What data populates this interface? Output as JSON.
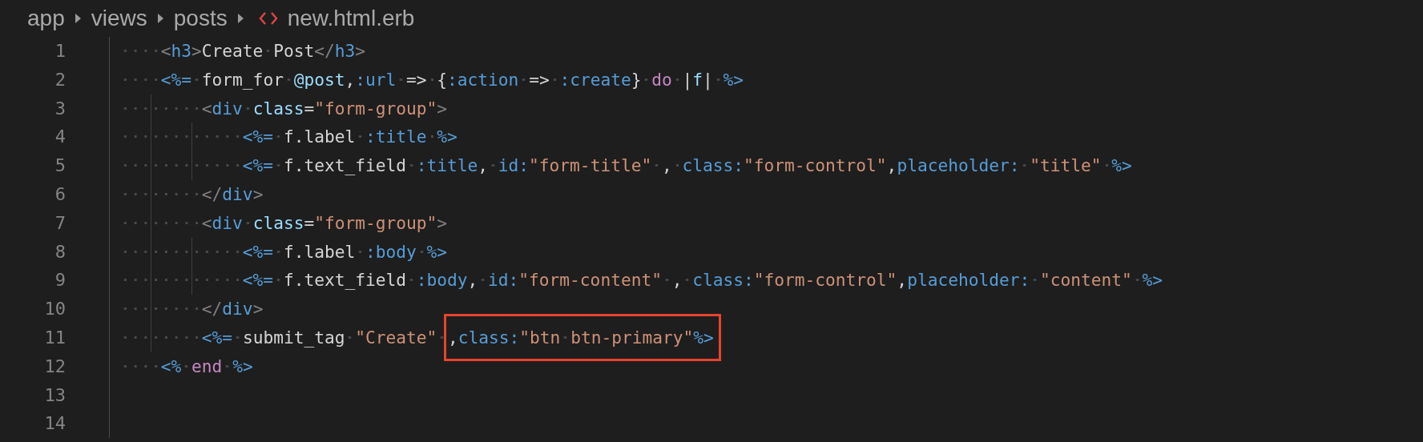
{
  "breadcrumb": [
    {
      "kind": "folder",
      "text": "app"
    },
    {
      "kind": "folder",
      "text": "views"
    },
    {
      "kind": "folder",
      "text": "posts"
    },
    {
      "kind": "file",
      "text": "new.html.erb"
    }
  ],
  "editor": {
    "lines": [
      {
        "number": "1",
        "tokens": [
          {
            "kind": "bracket",
            "text": "    <"
          },
          {
            "kind": "tag",
            "text": "h3"
          },
          {
            "kind": "bracket",
            "text": ">"
          },
          {
            "kind": "plain",
            "text": "Create Post"
          },
          {
            "kind": "bracket",
            "text": "</"
          },
          {
            "kind": "tag",
            "text": "h3"
          },
          {
            "kind": "bracket",
            "text": ">"
          }
        ]
      },
      {
        "number": "2",
        "tokens": [
          {
            "kind": "erb",
            "text": "    <%="
          },
          {
            "kind": "plain",
            "text": " form_for "
          },
          {
            "kind": "variable",
            "text": "@post"
          },
          {
            "kind": "plain",
            "text": ","
          },
          {
            "kind": "symbol",
            "text": ":url"
          },
          {
            "kind": "plain",
            "text": " => {"
          },
          {
            "kind": "symbol",
            "text": ":action"
          },
          {
            "kind": "plain",
            "text": " => "
          },
          {
            "kind": "symbol",
            "text": ":create"
          },
          {
            "kind": "plain",
            "text": "} "
          },
          {
            "kind": "keyword",
            "text": "do"
          },
          {
            "kind": "plain",
            "text": " |"
          },
          {
            "kind": "variable",
            "text": "f"
          },
          {
            "kind": "plain",
            "text": "| "
          },
          {
            "kind": "erb",
            "text": "%>"
          }
        ]
      },
      {
        "number": "3",
        "tokens": [
          {
            "kind": "bracket",
            "text": "        <"
          },
          {
            "kind": "tag",
            "text": "div"
          },
          {
            "kind": "attribute",
            "text": " class"
          },
          {
            "kind": "plain",
            "text": "="
          },
          {
            "kind": "string",
            "text": "\"form-group\""
          },
          {
            "kind": "bracket",
            "text": ">"
          }
        ]
      },
      {
        "number": "4",
        "tokens": [
          {
            "kind": "erb",
            "text": "            <%="
          },
          {
            "kind": "plain",
            "text": " f.label "
          },
          {
            "kind": "symbol",
            "text": ":title"
          },
          {
            "kind": "erb",
            "text": " %>"
          }
        ]
      },
      {
        "number": "5",
        "tokens": [
          {
            "kind": "erb",
            "text": "            <%="
          },
          {
            "kind": "plain",
            "text": " f.text_field "
          },
          {
            "kind": "symbol",
            "text": ":title"
          },
          {
            "kind": "plain",
            "text": ", "
          },
          {
            "kind": "symbol",
            "text": "id:"
          },
          {
            "kind": "string",
            "text": "\"form-title\""
          },
          {
            "kind": "plain",
            "text": " , "
          },
          {
            "kind": "symbol",
            "text": "class:"
          },
          {
            "kind": "string",
            "text": "\"form-control\""
          },
          {
            "kind": "plain",
            "text": ","
          },
          {
            "kind": "symbol",
            "text": "placeholder:"
          },
          {
            "kind": "string",
            "text": " \"title\""
          },
          {
            "kind": "erb",
            "text": " %>"
          }
        ]
      },
      {
        "number": "6",
        "tokens": [
          {
            "kind": "bracket",
            "text": "        </"
          },
          {
            "kind": "tag",
            "text": "div"
          },
          {
            "kind": "bracket",
            "text": ">"
          }
        ]
      },
      {
        "number": "7",
        "tokens": [
          {
            "kind": "bracket",
            "text": "        <"
          },
          {
            "kind": "tag",
            "text": "div"
          },
          {
            "kind": "attribute",
            "text": " class"
          },
          {
            "kind": "plain",
            "text": "="
          },
          {
            "kind": "string",
            "text": "\"form-group\""
          },
          {
            "kind": "bracket",
            "text": ">"
          }
        ]
      },
      {
        "number": "8",
        "tokens": [
          {
            "kind": "erb",
            "text": "            <%="
          },
          {
            "kind": "plain",
            "text": " f.label "
          },
          {
            "kind": "symbol",
            "text": ":body"
          },
          {
            "kind": "erb",
            "text": " %>"
          }
        ]
      },
      {
        "number": "9",
        "tokens": [
          {
            "kind": "erb",
            "text": "            <%="
          },
          {
            "kind": "plain",
            "text": " f.text_field "
          },
          {
            "kind": "symbol",
            "text": ":body"
          },
          {
            "kind": "plain",
            "text": ", "
          },
          {
            "kind": "symbol",
            "text": "id:"
          },
          {
            "kind": "string",
            "text": "\"form-content\""
          },
          {
            "kind": "plain",
            "text": " , "
          },
          {
            "kind": "symbol",
            "text": "class:"
          },
          {
            "kind": "string",
            "text": "\"form-control\""
          },
          {
            "kind": "plain",
            "text": ","
          },
          {
            "kind": "symbol",
            "text": "placeholder:"
          },
          {
            "kind": "string",
            "text": " \"content\""
          },
          {
            "kind": "erb",
            "text": " %>"
          }
        ]
      },
      {
        "number": "10",
        "tokens": [
          {
            "kind": "bracket",
            "text": "        </"
          },
          {
            "kind": "tag",
            "text": "div"
          },
          {
            "kind": "bracket",
            "text": ">"
          }
        ]
      },
      {
        "number": "11",
        "tokens": [
          {
            "kind": "erb",
            "text": "        <%="
          },
          {
            "kind": "plain",
            "text": " submit_tag "
          },
          {
            "kind": "string",
            "text": "\"Create\" "
          },
          {
            "kind": "annotation",
            "color": "#e8432c",
            "tokens": [
              {
                "kind": "plain",
                "text": ","
              },
              {
                "kind": "symbol",
                "text": "class:"
              },
              {
                "kind": "string",
                "text": "\"btn btn-primary\""
              },
              {
                "kind": "erb",
                "text": "%>"
              }
            ]
          }
        ]
      },
      {
        "number": "12",
        "tokens": [
          {
            "kind": "erb",
            "text": "    <%"
          },
          {
            "kind": "keyword",
            "text": " end"
          },
          {
            "kind": "erb",
            "text": " %>"
          }
        ]
      },
      {
        "number": "13"
      },
      {
        "number": "14"
      }
    ]
  }
}
